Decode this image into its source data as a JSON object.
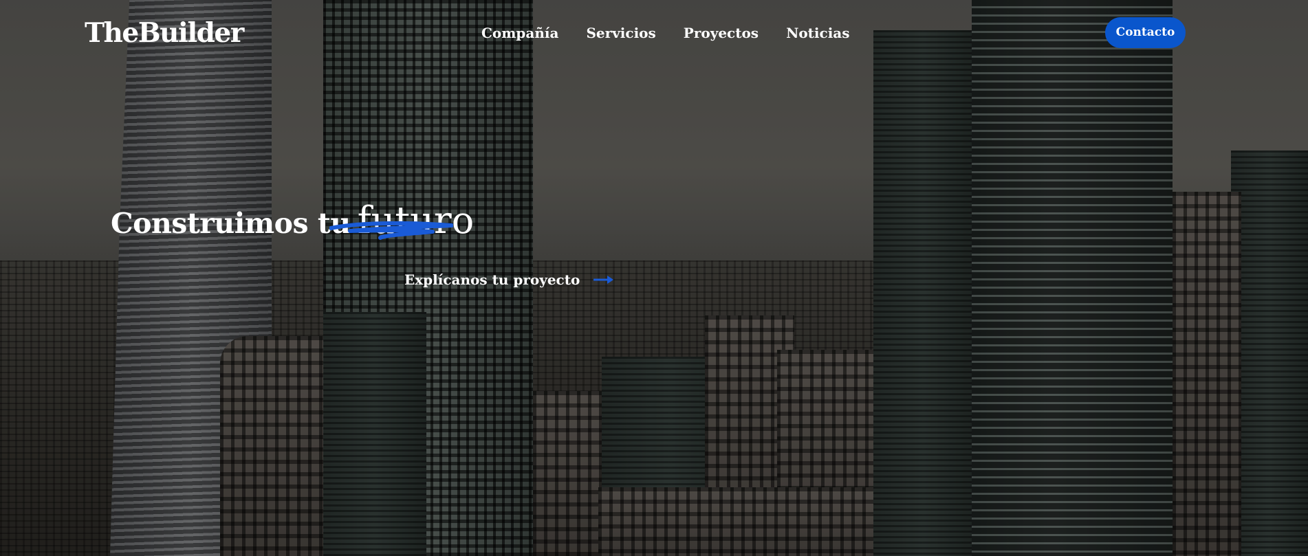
{
  "brand": {
    "logo_text": "TheBuilder"
  },
  "nav": {
    "items": [
      {
        "label": "Compañía"
      },
      {
        "label": "Servicios"
      },
      {
        "label": "Proyectos"
      },
      {
        "label": "Noticias"
      }
    ],
    "contact_label": "Contacto"
  },
  "hero": {
    "title_main": "Construimos tu",
    "title_accent": "futuro",
    "cta_label": "Explícanos tu proyecto"
  },
  "colors": {
    "accent": "#0a56cc",
    "underline": "#1a5bd6",
    "text": "#ffffff"
  },
  "icons": {
    "cta_arrow": "arrow-right-icon"
  }
}
